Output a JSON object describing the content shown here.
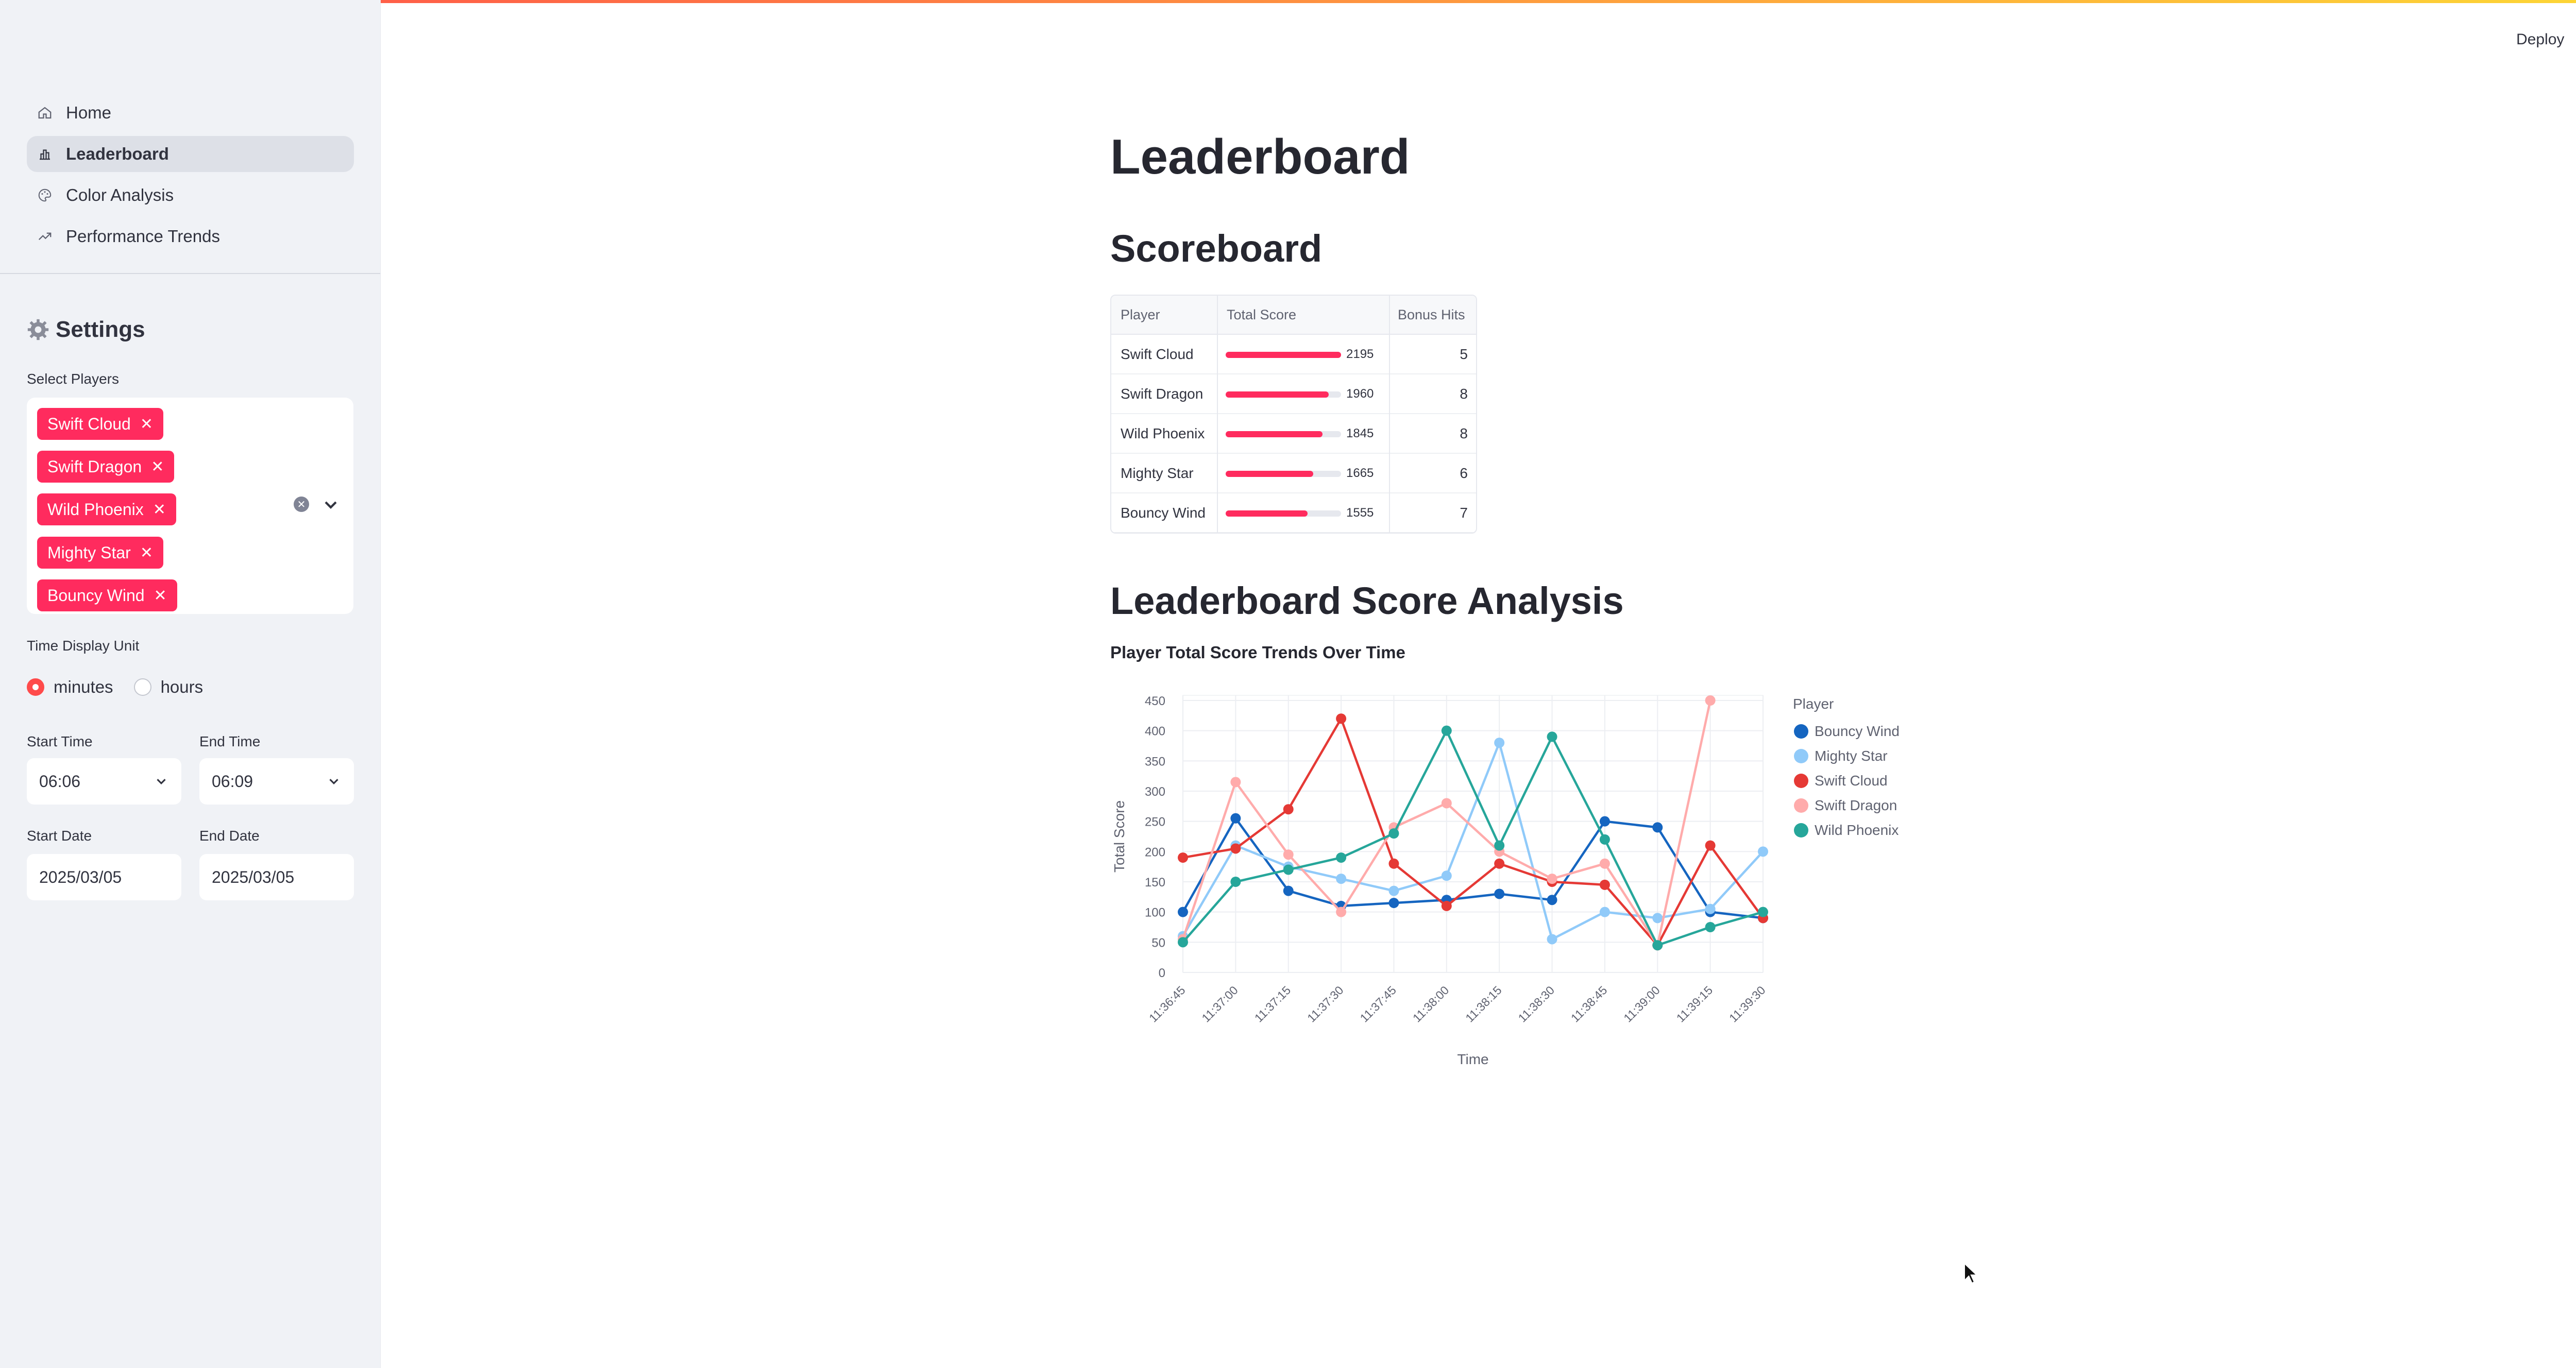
{
  "nav": {
    "items": [
      {
        "label": "Home",
        "icon": "home-icon",
        "active": false
      },
      {
        "label": "Leaderboard",
        "icon": "bar-chart-icon",
        "active": true
      },
      {
        "label": "Color Analysis",
        "icon": "palette-icon",
        "active": false
      },
      {
        "label": "Performance Trends",
        "icon": "trend-icon",
        "active": false
      }
    ]
  },
  "settings": {
    "title": "Settings",
    "select_players_label": "Select Players",
    "selected_players": [
      "Swift Cloud",
      "Swift Dragon",
      "Wild Phoenix",
      "Mighty Star",
      "Bouncy Wind"
    ],
    "time_unit_label": "Time Display Unit",
    "time_units": [
      "minutes",
      "hours"
    ],
    "time_unit_selected": "minutes",
    "start_time_label": "Start Time",
    "start_time": "06:06",
    "end_time_label": "End Time",
    "end_time": "06:09",
    "start_date_label": "Start Date",
    "start_date": "2025/03/05",
    "end_date_label": "End Date",
    "end_date": "2025/03/05"
  },
  "header": {
    "deploy_label": "Deploy"
  },
  "main": {
    "title": "Leaderboard",
    "scoreboard_heading": "Scoreboard",
    "analysis_heading": "Leaderboard Score Analysis",
    "chart_title": "Player Total Score Trends Over Time"
  },
  "scoreboard": {
    "columns": [
      "Player",
      "Total Score",
      "Bonus Hits"
    ],
    "max_score": 2195,
    "rows": [
      {
        "player": "Swift Cloud",
        "score": "2195",
        "bonus": "5"
      },
      {
        "player": "Swift Dragon",
        "score": "1960",
        "bonus": "8"
      },
      {
        "player": "Wild Phoenix",
        "score": "1845",
        "bonus": "8"
      },
      {
        "player": "Mighty Star",
        "score": "1665",
        "bonus": "6"
      },
      {
        "player": "Bouncy Wind",
        "score": "1555",
        "bonus": "7"
      }
    ]
  },
  "colors": {
    "accent": "#ff2b5e",
    "primary": "#ff4b4b"
  },
  "chart_data": {
    "type": "line",
    "xlabel": "Time",
    "ylabel": "Total Score",
    "legend_title": "Player",
    "legend_position": "right",
    "ylim": [
      0,
      450
    ],
    "yticks": [
      0,
      50,
      100,
      150,
      200,
      250,
      300,
      350,
      400,
      450
    ],
    "x": [
      "11:36:45",
      "11:37:00",
      "11:37:15",
      "11:37:30",
      "11:37:45",
      "11:38:00",
      "11:38:15",
      "11:38:30",
      "11:38:45",
      "11:39:00",
      "11:39:15",
      "11:39:30"
    ],
    "grid": true,
    "series": [
      {
        "name": "Bouncy Wind",
        "color": "#1565c0",
        "values": [
          100,
          255,
          135,
          110,
          115,
          120,
          130,
          120,
          250,
          240,
          100,
          90
        ]
      },
      {
        "name": "Mighty Star",
        "color": "#90caf9",
        "values": [
          60,
          210,
          175,
          155,
          135,
          160,
          380,
          55,
          100,
          90,
          105,
          200
        ]
      },
      {
        "name": "Swift Cloud",
        "color": "#e53935",
        "values": [
          190,
          205,
          270,
          420,
          180,
          110,
          180,
          150,
          145,
          45,
          210,
          90
        ]
      },
      {
        "name": "Swift Dragon",
        "color": "#ffabab",
        "values": [
          55,
          315,
          195,
          100,
          240,
          280,
          200,
          155,
          180,
          45,
          450,
          null
        ]
      },
      {
        "name": "Wild Phoenix",
        "color": "#26a69a",
        "values": [
          50,
          150,
          170,
          190,
          230,
          400,
          210,
          390,
          220,
          45,
          75,
          100
        ]
      }
    ]
  }
}
